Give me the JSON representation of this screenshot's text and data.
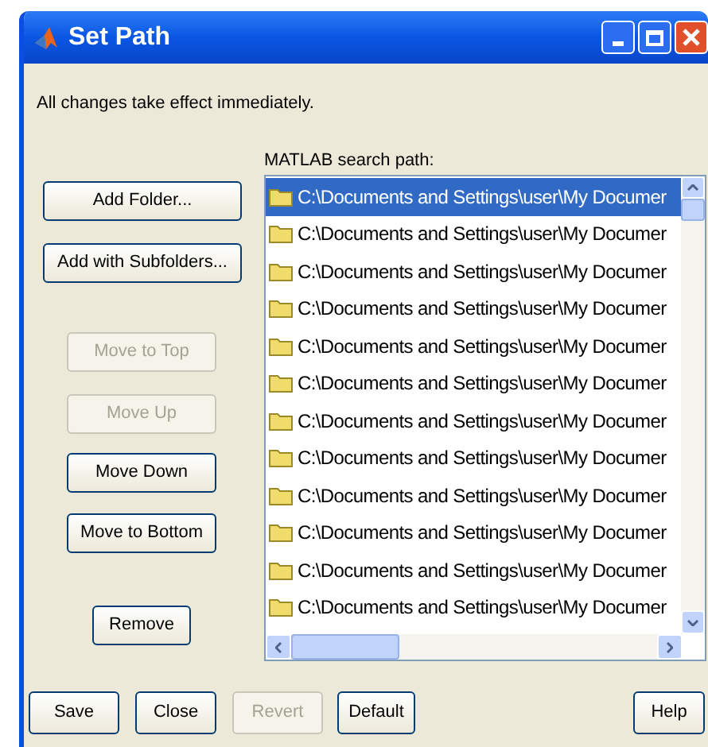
{
  "window": {
    "title": "Set Path"
  },
  "message": "All changes take effect immediately.",
  "side_buttons": [
    {
      "label": "Add Folder...",
      "disabled": false
    },
    {
      "label": "Add with Subfolders...",
      "disabled": false
    },
    {
      "label": "Move to Top",
      "disabled": true
    },
    {
      "label": "Move Up",
      "disabled": true
    },
    {
      "label": "Move Down",
      "disabled": false
    },
    {
      "label": "Move to Bottom",
      "disabled": false
    },
    {
      "label": "Remove",
      "disabled": false
    }
  ],
  "path_list": {
    "label": "MATLAB search path:",
    "items": [
      {
        "text": "C:\\Documents and Settings\\user\\My Documer",
        "selected": true
      },
      {
        "text": "C:\\Documents and Settings\\user\\My Documer",
        "selected": false
      },
      {
        "text": "C:\\Documents and Settings\\user\\My Documer",
        "selected": false
      },
      {
        "text": "C:\\Documents and Settings\\user\\My Documer",
        "selected": false
      },
      {
        "text": "C:\\Documents and Settings\\user\\My Documer",
        "selected": false
      },
      {
        "text": "C:\\Documents and Settings\\user\\My Documer",
        "selected": false
      },
      {
        "text": "C:\\Documents and Settings\\user\\My Documer",
        "selected": false
      },
      {
        "text": "C:\\Documents and Settings\\user\\My Documer",
        "selected": false
      },
      {
        "text": "C:\\Documents and Settings\\user\\My Documer",
        "selected": false
      },
      {
        "text": "C:\\Documents and Settings\\user\\My Documer",
        "selected": false
      },
      {
        "text": "C:\\Documents and Settings\\user\\My Documer",
        "selected": false
      },
      {
        "text": "C:\\Documents and Settings\\user\\My Documer",
        "selected": false
      }
    ]
  },
  "bottom_buttons": [
    {
      "label": "Save",
      "disabled": false
    },
    {
      "label": "Close",
      "disabled": false
    },
    {
      "label": "Revert",
      "disabled": true
    },
    {
      "label": "Default",
      "disabled": false
    },
    {
      "label": "Help",
      "disabled": false
    }
  ]
}
